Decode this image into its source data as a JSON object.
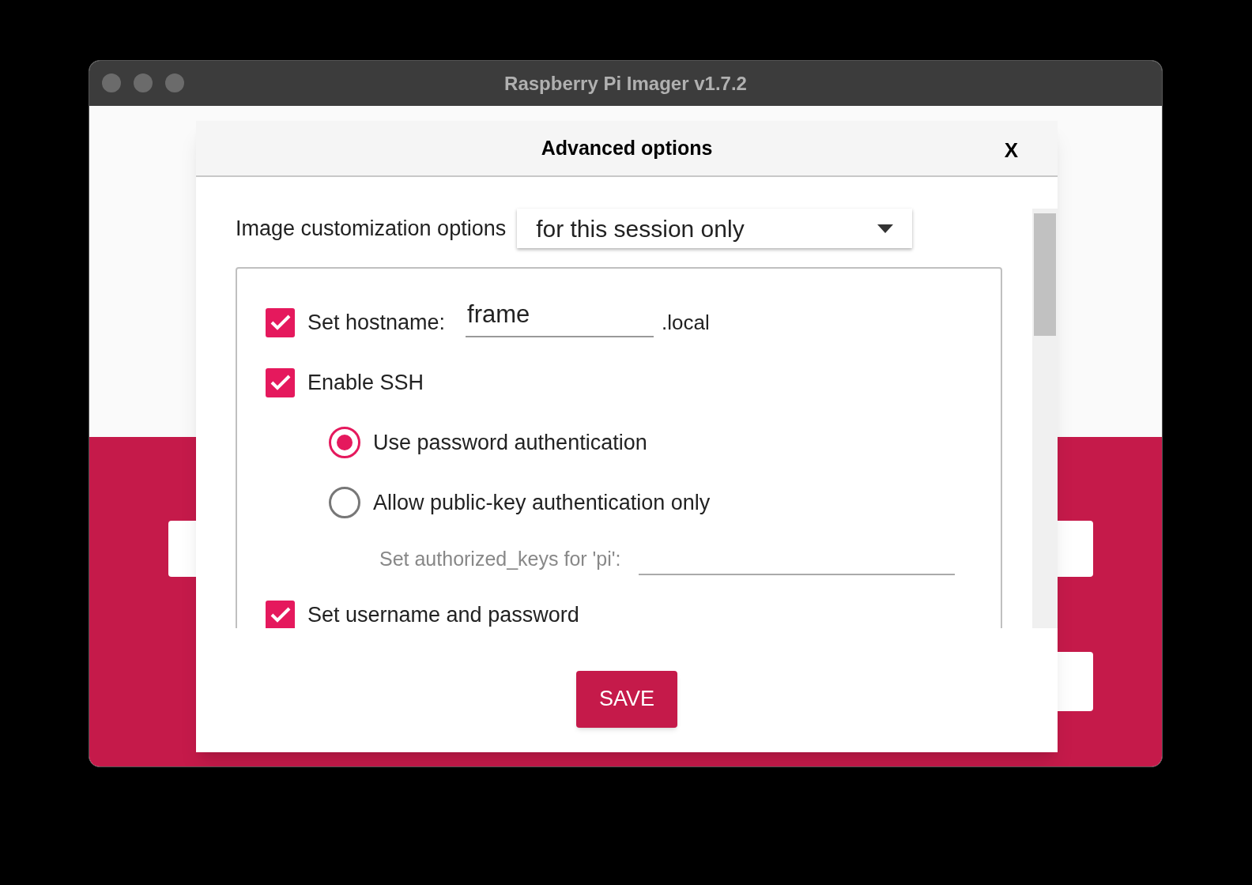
{
  "window": {
    "title": "Raspberry Pi Imager v1.7.2"
  },
  "dialog": {
    "title": "Advanced options",
    "close": "X",
    "customization": {
      "label": "Image customization options",
      "value": "for this session only"
    },
    "options": [
      {
        "kind": "checkbox",
        "label": "Set hostname:",
        "checked": true,
        "value": "frame",
        "suffix": ".local"
      },
      {
        "kind": "checkbox",
        "label": "Enable SSH",
        "checked": true
      },
      {
        "kind": "radio",
        "label": "Use password authentication",
        "selected": true
      },
      {
        "kind": "radio",
        "label": "Allow public-key authentication only",
        "selected": false
      },
      {
        "kind": "field",
        "label": "Set authorized_keys for 'pi':",
        "disabled": true
      },
      {
        "kind": "checkbox",
        "label": "Set username and password",
        "checked": true
      }
    ],
    "save": "SAVE"
  }
}
